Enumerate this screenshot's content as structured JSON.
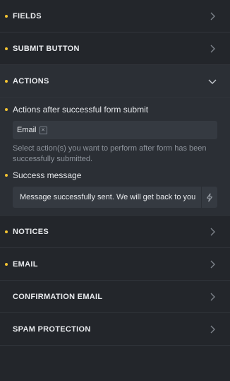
{
  "sections": {
    "fields": {
      "title": "FIELDS"
    },
    "submit_button": {
      "title": "SUBMIT BUTTON"
    },
    "actions": {
      "title": "ACTIONS",
      "actions_label": "Actions after successful form submit",
      "actions_tags": [
        "Email"
      ],
      "actions_help": "Select action(s) you want to perform after form has been successfully submitted.",
      "success_label": "Success message",
      "success_value": "Message successfully sent. We will get back to you"
    },
    "notices": {
      "title": "NOTICES"
    },
    "email": {
      "title": "EMAIL"
    },
    "confirmation_email": {
      "title": "CONFIRMATION EMAIL"
    },
    "spam_protection": {
      "title": "SPAM PROTECTION"
    }
  },
  "icons": {
    "collapsed": "chevron-right-icon",
    "expanded": "chevron-down-icon",
    "tag_remove": "close-icon",
    "dynamic_data": "lightning-icon"
  },
  "colors": {
    "background": "#23262b",
    "active_section": "#2b2f35",
    "indicator_dot": "#f3c331",
    "text": "#e6e8eb",
    "muted": "#8e949c"
  }
}
